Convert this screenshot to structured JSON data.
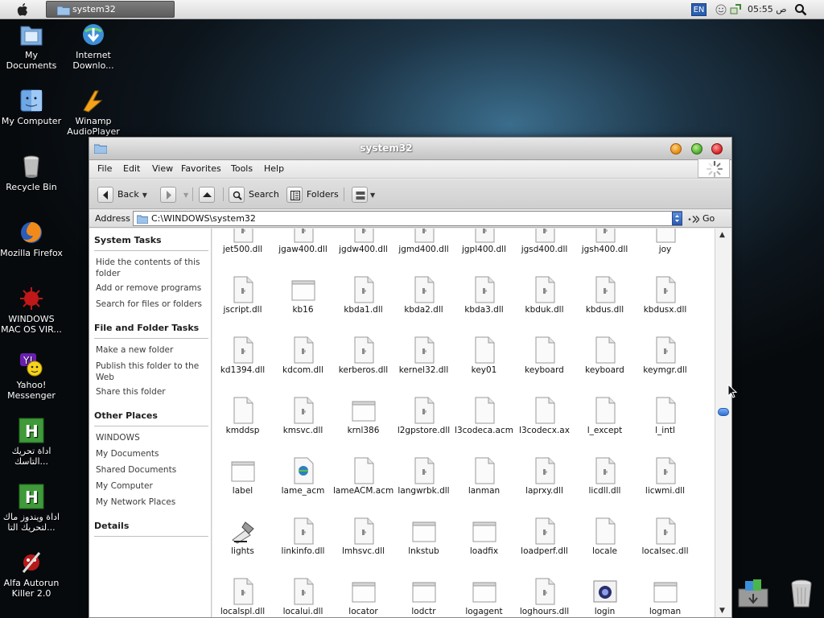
{
  "menubar": {
    "task_title": "system32",
    "lang": "EN",
    "clock": "05:55 ص"
  },
  "desktop": {
    "icons": [
      {
        "label": "My Documents"
      },
      {
        "label": "Internet Downlo..."
      },
      {
        "label": "My Computer"
      },
      {
        "label": "Winamp AudioPlayer"
      },
      {
        "label": "Recycle Bin"
      },
      {
        "label": "Mozilla Firefox"
      },
      {
        "label": "WINDOWS MAC OS VIR..."
      },
      {
        "label": "Yahoo! Messenger"
      },
      {
        "label": "اداة تحريك التاسك..."
      },
      {
        "label": "اداة ويندوز ماك لتحريك التا..."
      },
      {
        "label": "Alfa Autorun Killer 2.0"
      }
    ]
  },
  "window": {
    "title": "system32",
    "menu": [
      "File",
      "Edit",
      "View",
      "Favorites",
      "Tools",
      "Help"
    ],
    "toolbar": {
      "back": "Back",
      "search": "Search",
      "folders": "Folders"
    },
    "address": {
      "label": "Address",
      "value": "C:\\WINDOWS\\system32",
      "go": "Go"
    },
    "left_pane": {
      "system_tasks": {
        "title": "System Tasks",
        "items": [
          "Hide the contents of this folder",
          "Add or remove programs",
          "Search for files or folders"
        ]
      },
      "file_tasks": {
        "title": "File and Folder Tasks",
        "items": [
          "Make a new folder",
          "Publish this folder to the Web",
          "Share this folder"
        ]
      },
      "other_places": {
        "title": "Other Places",
        "items": [
          "WINDOWS",
          "My Documents",
          "Shared Documents",
          "My Computer",
          "My Network Places"
        ]
      },
      "details": {
        "title": "Details"
      }
    },
    "files": [
      [
        "jet500.dll",
        "jgaw400.dll",
        "jgdw400.dll",
        "jgmd400.dll",
        "jgpl400.dll",
        "jgsd400.dll",
        "jgsh400.dll",
        "joy"
      ],
      [
        "jscript.dll",
        "kb16",
        "kbda1.dll",
        "kbda2.dll",
        "kbda3.dll",
        "kbduk.dll",
        "kbdus.dll",
        "kbdusx.dll"
      ],
      [
        "kd1394.dll",
        "kdcom.dll",
        "kerberos.dll",
        "kernel32.dll",
        "key01",
        "keyboard",
        "keyboard",
        "keymgr.dll"
      ],
      [
        "kmddsp",
        "kmsvc.dll",
        "krnl386",
        "l2gpstore.dll",
        "l3codeca.acm",
        "l3codecx.ax",
        "l_except",
        "l_intl"
      ],
      [
        "label",
        "lame_acm",
        "lameACM.acm",
        "langwrbk.dll",
        "lanman",
        "laprxy.dll",
        "licdll.dll",
        "licwmi.dll"
      ],
      [
        "lights",
        "linkinfo.dll",
        "lmhsvc.dll",
        "lnkstub",
        "loadfix",
        "loadperf.dll",
        "locale",
        "localsec.dll"
      ],
      [
        "localspl.dll",
        "localui.dll",
        "locator",
        "lodctr",
        "logagent",
        "loghours.dll",
        "login",
        "logman"
      ]
    ],
    "file_types": [
      [
        "dll",
        "dll",
        "dll",
        "dll",
        "dll",
        "dll",
        "dll",
        "doc"
      ],
      [
        "dll",
        "exe",
        "dll",
        "dll",
        "dll",
        "dll",
        "dll",
        "dll"
      ],
      [
        "dll",
        "dll",
        "dll",
        "dll",
        "doc",
        "doc",
        "doc",
        "dll"
      ],
      [
        "doc",
        "dll",
        "exe",
        "dll",
        "doc",
        "doc",
        "doc",
        "doc"
      ],
      [
        "exe",
        "lame",
        "doc",
        "dll",
        "doc",
        "dll",
        "dll",
        "dll"
      ],
      [
        "lights",
        "dll",
        "dll",
        "exe",
        "exe",
        "dll",
        "doc",
        "dll"
      ],
      [
        "dll",
        "dll",
        "exe",
        "exe",
        "exe",
        "dll",
        "login",
        "exe"
      ]
    ],
    "scroll_position": 0.47
  }
}
